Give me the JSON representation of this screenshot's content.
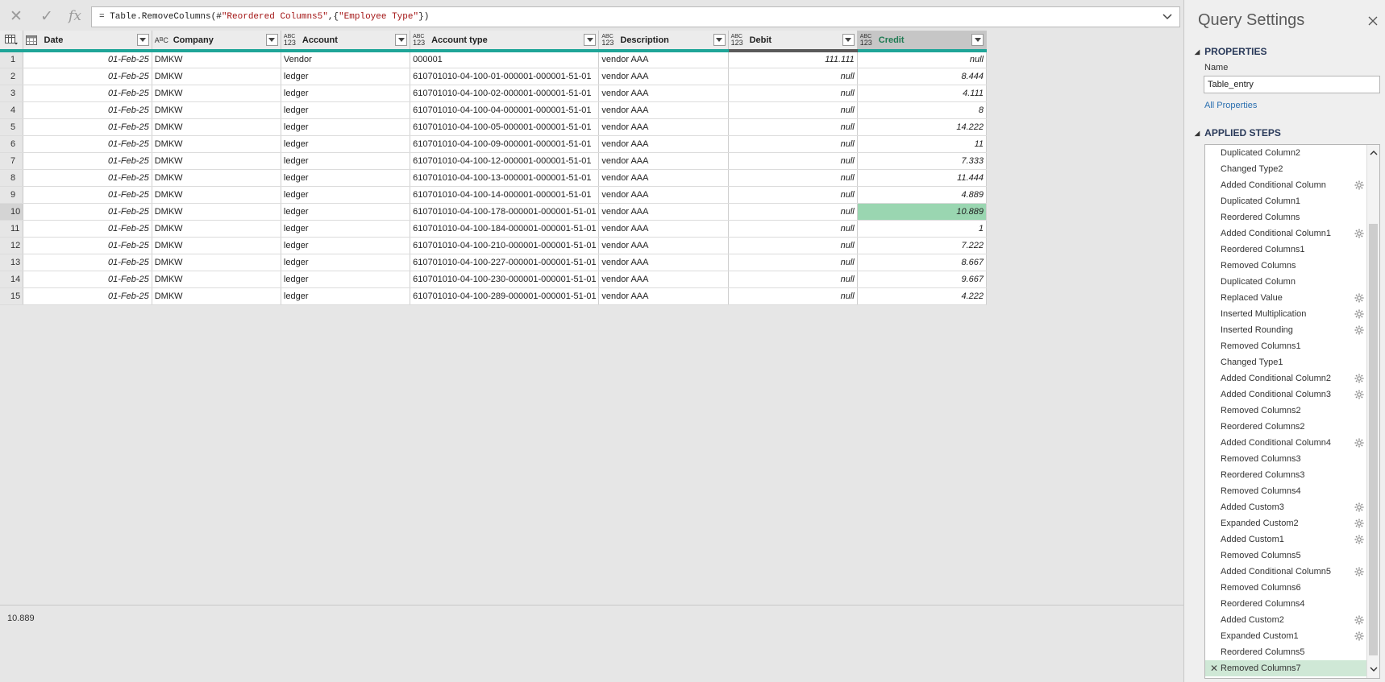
{
  "formula": {
    "prefix": "= Table.RemoveColumns(#",
    "s1": "\"Reordered Columns5\"",
    "mid": ",{",
    "s2": "\"Employee Type\"",
    "suffix": "})"
  },
  "columns": [
    {
      "label": "Date",
      "type": "calendar"
    },
    {
      "label": "Company",
      "type": "ABC"
    },
    {
      "label": "Account",
      "type": "ABC123"
    },
    {
      "label": "Account type",
      "type": "ABC123"
    },
    {
      "label": "Description",
      "type": "ABC123"
    },
    {
      "label": "Debit",
      "type": "ABC123"
    },
    {
      "label": "Credit",
      "type": "ABC123"
    }
  ],
  "rows": [
    {
      "n": "1",
      "date": "01-Feb-25",
      "company": "DMKW",
      "account": "Vendor",
      "account_type": "000001",
      "description": "vendor AAA",
      "debit": "111.111",
      "credit": "null"
    },
    {
      "n": "2",
      "date": "01-Feb-25",
      "company": "DMKW",
      "account": "ledger",
      "account_type": "610701010-04-100-01-000001-000001-51-01",
      "description": "vendor AAA",
      "debit": "null",
      "credit": "8.444"
    },
    {
      "n": "3",
      "date": "01-Feb-25",
      "company": "DMKW",
      "account": "ledger",
      "account_type": "610701010-04-100-02-000001-000001-51-01",
      "description": "vendor AAA",
      "debit": "null",
      "credit": "4.111"
    },
    {
      "n": "4",
      "date": "01-Feb-25",
      "company": "DMKW",
      "account": "ledger",
      "account_type": "610701010-04-100-04-000001-000001-51-01",
      "description": "vendor AAA",
      "debit": "null",
      "credit": "8"
    },
    {
      "n": "5",
      "date": "01-Feb-25",
      "company": "DMKW",
      "account": "ledger",
      "account_type": "610701010-04-100-05-000001-000001-51-01",
      "description": "vendor AAA",
      "debit": "null",
      "credit": "14.222"
    },
    {
      "n": "6",
      "date": "01-Feb-25",
      "company": "DMKW",
      "account": "ledger",
      "account_type": "610701010-04-100-09-000001-000001-51-01",
      "description": "vendor AAA",
      "debit": "null",
      "credit": "11"
    },
    {
      "n": "7",
      "date": "01-Feb-25",
      "company": "DMKW",
      "account": "ledger",
      "account_type": "610701010-04-100-12-000001-000001-51-01",
      "description": "vendor AAA",
      "debit": "null",
      "credit": "7.333"
    },
    {
      "n": "8",
      "date": "01-Feb-25",
      "company": "DMKW",
      "account": "ledger",
      "account_type": "610701010-04-100-13-000001-000001-51-01",
      "description": "vendor AAA",
      "debit": "null",
      "credit": "11.444"
    },
    {
      "n": "9",
      "date": "01-Feb-25",
      "company": "DMKW",
      "account": "ledger",
      "account_type": "610701010-04-100-14-000001-000001-51-01",
      "description": "vendor AAA",
      "debit": "null",
      "credit": "4.889"
    },
    {
      "n": "10",
      "date": "01-Feb-25",
      "company": "DMKW",
      "account": "ledger",
      "account_type": "610701010-04-100-178-000001-000001-51-01",
      "description": "vendor AAA",
      "debit": "null",
      "credit": "10.889"
    },
    {
      "n": "11",
      "date": "01-Feb-25",
      "company": "DMKW",
      "account": "ledger",
      "account_type": "610701010-04-100-184-000001-000001-51-01",
      "description": "vendor AAA",
      "debit": "null",
      "credit": "1"
    },
    {
      "n": "12",
      "date": "01-Feb-25",
      "company": "DMKW",
      "account": "ledger",
      "account_type": "610701010-04-100-210-000001-000001-51-01",
      "description": "vendor AAA",
      "debit": "null",
      "credit": "7.222"
    },
    {
      "n": "13",
      "date": "01-Feb-25",
      "company": "DMKW",
      "account": "ledger",
      "account_type": "610701010-04-100-227-000001-000001-51-01",
      "description": "vendor AAA",
      "debit": "null",
      "credit": "8.667"
    },
    {
      "n": "14",
      "date": "01-Feb-25",
      "company": "DMKW",
      "account": "ledger",
      "account_type": "610701010-04-100-230-000001-000001-51-01",
      "description": "vendor AAA",
      "debit": "null",
      "credit": "9.667"
    },
    {
      "n": "15",
      "date": "01-Feb-25",
      "company": "DMKW",
      "account": "ledger",
      "account_type": "610701010-04-100-289-000001-000001-51-01",
      "description": "vendor AAA",
      "debit": "null",
      "credit": "4.222"
    }
  ],
  "status": {
    "value": "10.889"
  },
  "pane": {
    "title": "Query Settings",
    "properties_heading": "PROPERTIES",
    "name_label": "Name",
    "name_value": "Table_entry",
    "all_properties": "All Properties",
    "steps_heading": "APPLIED STEPS"
  },
  "steps": [
    {
      "label": "Duplicated Column2",
      "gear": false
    },
    {
      "label": "Changed Type2",
      "gear": false
    },
    {
      "label": "Added Conditional Column",
      "gear": true
    },
    {
      "label": "Duplicated Column1",
      "gear": false
    },
    {
      "label": "Reordered Columns",
      "gear": false
    },
    {
      "label": "Added Conditional Column1",
      "gear": true
    },
    {
      "label": "Reordered Columns1",
      "gear": false
    },
    {
      "label": "Removed Columns",
      "gear": false
    },
    {
      "label": "Duplicated Column",
      "gear": false
    },
    {
      "label": "Replaced Value",
      "gear": true
    },
    {
      "label": "Inserted Multiplication",
      "gear": true
    },
    {
      "label": "Inserted Rounding",
      "gear": true
    },
    {
      "label": "Removed Columns1",
      "gear": false
    },
    {
      "label": "Changed Type1",
      "gear": false
    },
    {
      "label": "Added Conditional Column2",
      "gear": true
    },
    {
      "label": "Added Conditional Column3",
      "gear": true
    },
    {
      "label": "Removed Columns2",
      "gear": false
    },
    {
      "label": "Reordered Columns2",
      "gear": false
    },
    {
      "label": "Added Conditional Column4",
      "gear": true
    },
    {
      "label": "Removed Columns3",
      "gear": false
    },
    {
      "label": "Reordered Columns3",
      "gear": false
    },
    {
      "label": "Removed Columns4",
      "gear": false
    },
    {
      "label": "Added Custom3",
      "gear": true
    },
    {
      "label": "Expanded Custom2",
      "gear": true
    },
    {
      "label": "Added Custom1",
      "gear": true
    },
    {
      "label": "Removed Columns5",
      "gear": false
    },
    {
      "label": "Added Conditional Column5",
      "gear": true
    },
    {
      "label": "Removed Columns6",
      "gear": false
    },
    {
      "label": "Reordered Columns4",
      "gear": false
    },
    {
      "label": "Added Custom2",
      "gear": true
    },
    {
      "label": "Expanded Custom1",
      "gear": true
    },
    {
      "label": "Reordered Columns5",
      "gear": false
    },
    {
      "label": "Removed Columns7",
      "gear": false,
      "current": true
    }
  ]
}
